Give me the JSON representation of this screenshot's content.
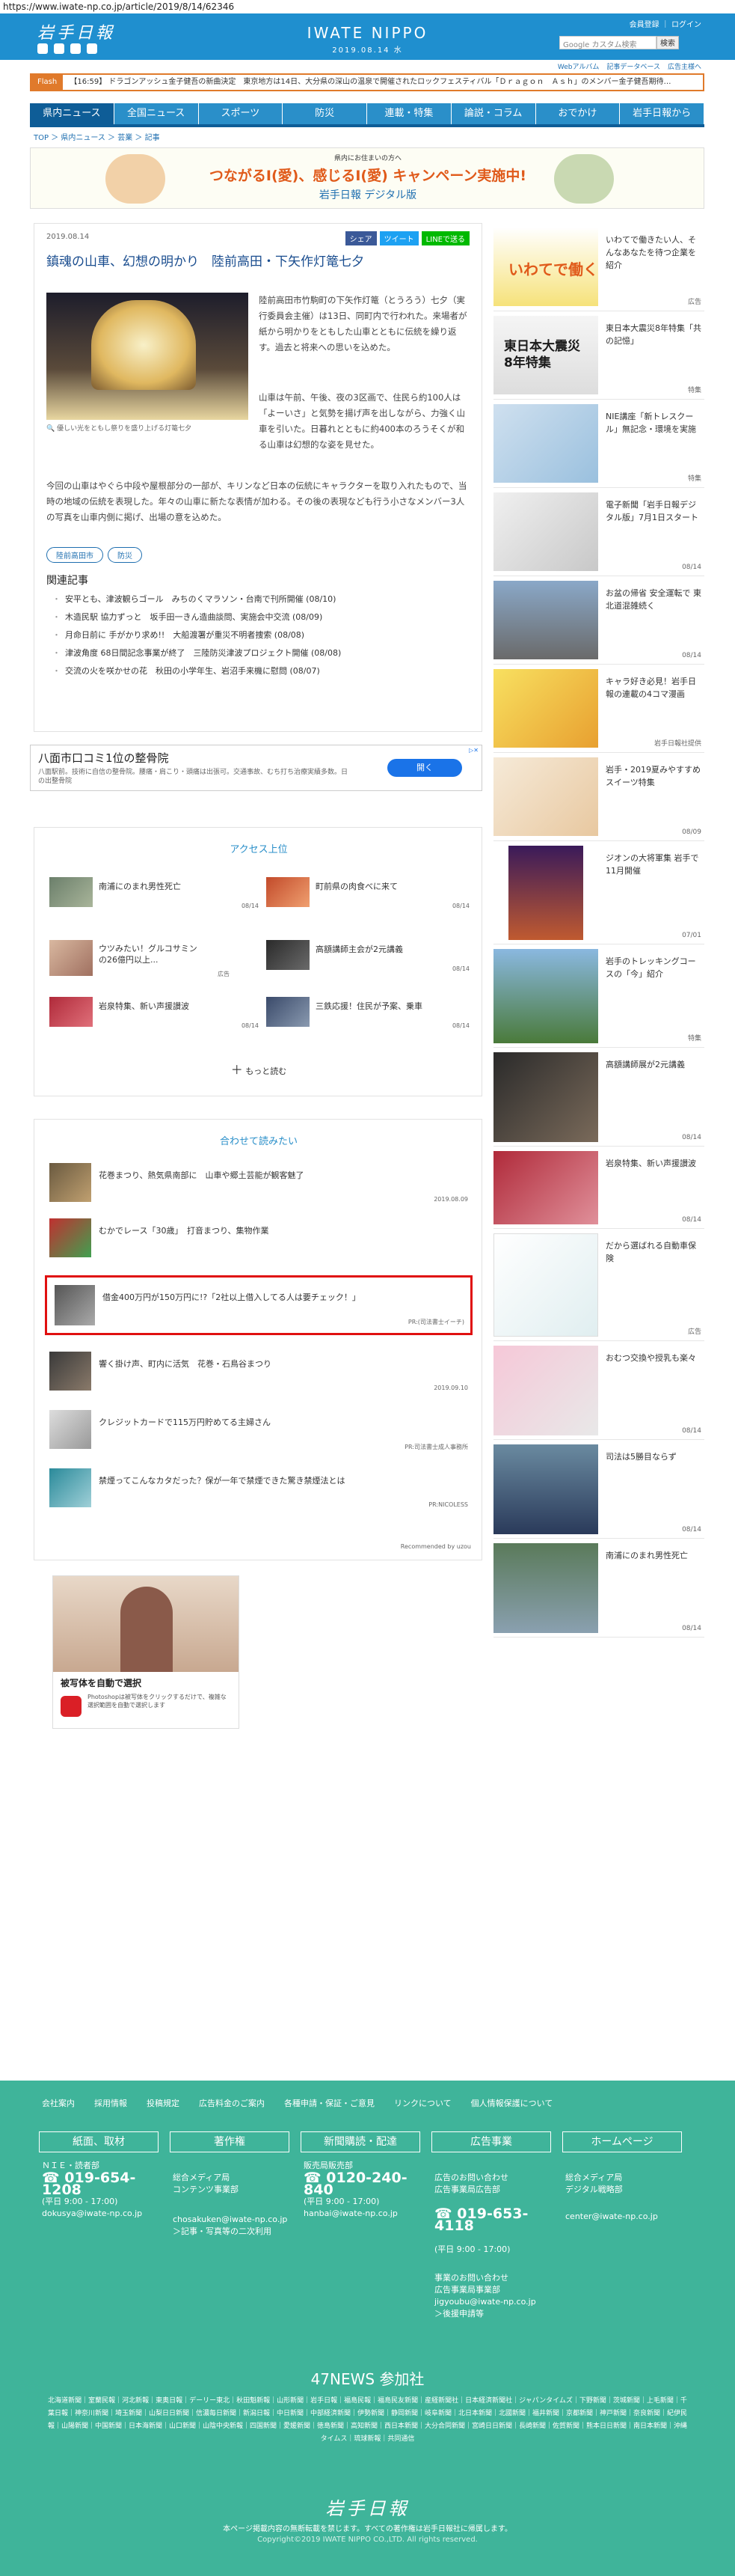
{
  "browser": {
    "url": "https://www.iwate-np.co.jp/article/2019/8/14/62346"
  },
  "header": {
    "logo": "岩手日報",
    "center_logo": "IWATE NIPPO",
    "date_line": "2019.08.14 水",
    "links": [
      "会員登録",
      "ログイン"
    ],
    "sub_links": [
      "Webアルバム",
      "記事データベース",
      "広告主様へ"
    ],
    "search_placeholder": "Google カスタム検索",
    "search_button": "検索"
  },
  "flash": {
    "label": "Flash",
    "text": "【16:59】 ドラゴンアッシュ金子健吾の新曲決定　東京地方は14日、大分県の深山の温泉で開催されたロックフェスティバル「Ｄｒａｇｏｎ　Ａｓｈ」のメンバー金子健吾期待…"
  },
  "nav": [
    "県内ニュース",
    "全国ニュース",
    "スポーツ",
    "防災",
    "連載・特集",
    "論説・コラム",
    "おでかけ",
    "岩手日報から"
  ],
  "breadcrumb": "TOP ＞ 県内ニュース ＞ 芸業 ＞ 記事",
  "banner": {
    "small": "県内にお住まいの方へ",
    "headline": "つながるI(愛)、感じるI(愛) キャンペーン実施中!",
    "sub": "岩手日報 デジタル版"
  },
  "article": {
    "date": "2019.08.14",
    "share": [
      "シェア",
      "ツイート",
      "LINEで送る"
    ],
    "title": "鎮魂の山車、幻想の明かり　陸前高田・下矢作灯篭七夕",
    "caption": "優しい光をともし祭りを盛り上げる灯篭七夕",
    "para1": "陸前高田市竹駒町の下矢作灯篭（とうろう）七夕（実行委員会主催）は13日、同町内で行われた。来場者が紙から明かりをともした山車とともに伝統を繰り返す。過去と将来への思いを込めた。",
    "para2": "山車は午前、午後、夜の3区画で、住民ら約100人は「よーいさ」と気勢を揚げ声を出しながら、力強く山車を引いた。日暮れとともに約400本のろうそくが和る山車は幻想的な姿を見せた。",
    "para3": "今回の山車はやぐら中段や屋根部分の一部が、キリンなど日本の伝統にキャラクターを取り入れたもので、当時の地域の伝統を表現した。年々の山車に新たな表情が加わる。その後の表現なども行う小さなメンバー3人の写真を山車内側に掲げ、出場の意を込めた。",
    "tags": [
      "陸前高田市",
      "防災"
    ],
    "related_title": "関連記事",
    "related": [
      "安平とも、津波観らゴール　みちのくマラソン・台南で刊所開催 (08/10)",
      "木造民駅 協力ずっと　坂手田一きん造曲談問、実施会中交流 (08/09)",
      "月命日前に 手がかり求め!!　大船渡署が重災不明者捜索 (08/08)",
      "津波角度 68日間記念事業が終了　三陸防災津波プロジェクト開催 (08/08)",
      "交流の火を咲かせの花　秋田の小学年生、岩沼手来機に慰問 (08/07)"
    ]
  },
  "ad": {
    "title": "八面市口コミ1位の整骨院",
    "body": "八面駅前。技術に自信の整骨院。腰痛・肩こり・頭痛は出張可。交通事故、むち打ち治療実績多数。日の出整骨院",
    "button": "開く"
  },
  "access": {
    "title": "アクセス上位",
    "items": [
      {
        "text": "南浦にのまれ男性死亡",
        "date": "08/14"
      },
      {
        "text": "町前県の肉食べに来て",
        "date": "08/14"
      },
      {
        "text": "ウツみたい！グルコサミンの26億円以上...",
        "date": "広告"
      },
      {
        "text": "高額講師主会が2元講義",
        "date": "08/14"
      },
      {
        "text": "岩泉特集、新い声援讃波",
        "date": "08/14"
      },
      {
        "text": "三鉄応援！住民が予案、乗車",
        "date": "08/14"
      }
    ],
    "more": "もっと読む"
  },
  "together": {
    "title": "合わせて読みたい",
    "items": [
      {
        "text": "花巻まつり、熱気県南部に　山車や郷土芸能が観客魅了",
        "meta": "2019.08.09"
      },
      {
        "text": "むかでレース「30歳」　打音まつり、集物作業",
        "meta": ""
      },
      {
        "text": "借金400万円が150万円に!?「2社以上借入してる人は要チェック！」",
        "meta": "PR:(司法書士イーチ)"
      },
      {
        "text": "響く掛け声、町内に活気　花巻・石鳥谷まつり",
        "meta": "2019.09.10"
      },
      {
        "text": "クレジットカードで115万円貯めてる主婦さん",
        "meta": "PR:司法書士成人事務所"
      },
      {
        "text": "禁煙ってこんなカタだった？保が一年で禁煙できた驚き禁煙法とは",
        "meta": "PR:NICOLESS"
      }
    ],
    "recommended": "Recommended by uzou"
  },
  "ad2": {
    "heading": "被写体を自動で選択",
    "body": "Photoshopは被写体をクリックするだけで、複雑な選択範囲を自動で選択します"
  },
  "sidebar": [
    {
      "text": "いわてで働きたい人、そんなあなたを待つ企業を紹介",
      "date": "広告"
    },
    {
      "text": "東日本大震災8年特集「共の記憶」",
      "date": "特集"
    },
    {
      "text": "NIE講座「新トレスクール」無記念・環境を実施",
      "date": "特集"
    },
    {
      "text": "電子新聞「岩手日報デジタル版」7月1日スタート",
      "date": "08/14"
    },
    {
      "text": "お盆の帰省 安全運転で 東北道混雑続く",
      "date": "08/14"
    },
    {
      "text": "キャラ好き必見！岩手日報の連載の4コマ漫画",
      "date": "岩手日報社提供"
    },
    {
      "text": "岩手・2019夏みやすすめスイーツ特集",
      "date": "08/09"
    },
    {
      "text": "ジオンの大将軍集 岩手で11月開催",
      "date": "07/01"
    },
    {
      "text": "岩手のトレッキングコースの「今」紹介",
      "date": "特集"
    },
    {
      "text": "高額講師展が2元講義",
      "date": "08/14"
    },
    {
      "text": "岩泉特集、新い声援讃波",
      "date": "08/14"
    },
    {
      "text": "だから選ばれる自動車保険",
      "date": "広告"
    },
    {
      "text": "おむつ交換や授乳も楽々",
      "date": "08/14"
    },
    {
      "text": "司法は5勝目ならず",
      "date": "08/14"
    },
    {
      "text": "南浦にのまれ男性死亡",
      "date": "08/14"
    }
  ],
  "footer": {
    "top_links": [
      "会社案内",
      "採用情報",
      "投稿規定",
      "広告料金のご案内",
      "各種申請・保証・ご意見",
      "リンクについて",
      "個人情報保護について"
    ],
    "boxes": [
      "紙面、取材",
      "著作権",
      "新聞購読・配達",
      "広告事業",
      "ホームページ"
    ],
    "cols": [
      {
        "label": "ＮＩＥ・読者部",
        "tel": "019-654-1208",
        "hours": "(平日 9:00 - 17:00)",
        "mail": "dokusya@iwate-np.co.jp"
      },
      {
        "label": "総合メディア局\nコンテンツ事業部",
        "tel": "",
        "hours": "",
        "mail": "chosakuken@iwate-np.co.jp\n＞記事・写真等の二次利用"
      },
      {
        "label": "販売局販売部",
        "tel": "0120-240-840",
        "hours": "(平日 9:00 - 17:00)",
        "mail": "hanbai@iwate-np.co.jp"
      },
      {
        "label": "広告のお問い合わせ\n広告事業局広告部",
        "tel": "019-653-4118",
        "hours": "(平日 9:00 - 17:00)",
        "mail": "事業のお問い合わせ\n広告事業局事業部\njigyoubu@iwate-np.co.jp\n＞後援申請等"
      },
      {
        "label": "総合メディア局\nデジタル戦略部",
        "tel": "",
        "hours": "",
        "mail": "center@iwate-np.co.jp"
      }
    ],
    "news47_title": "47NEWS 参加社",
    "news47": "北海道新聞｜室蘭民報｜河北新報｜東奥日報｜デーリー東北｜秋田魁新報｜山形新聞｜岩手日報｜福島民報｜福島民友新聞｜産経新聞社｜日本経済新聞社｜ジャパンタイムズ｜下野新聞｜茨城新聞｜上毛新聞｜千葉日報｜神奈川新聞｜埼玉新聞｜山梨日日新聞｜信濃毎日新聞｜新潟日報｜中日新聞｜中部経済新聞｜伊勢新聞｜静岡新聞｜岐阜新聞｜北日本新聞｜北國新聞｜福井新聞｜京都新聞｜神戸新聞｜奈良新聞｜紀伊民報｜山陽新聞｜中国新聞｜日本海新聞｜山口新聞｜山陰中央新報｜四国新聞｜愛媛新聞｜徳島新聞｜高知新聞｜西日本新聞｜大分合同新聞｜宮崎日日新聞｜長崎新聞｜佐賀新聞｜熊本日日新聞｜南日本新聞｜沖縄タイムス｜琉球新報｜共同通信",
    "logo": "岩手日報",
    "notice": "本ページ掲載内容の無断転載を禁じます。すべての著作権は岩手日報社に帰属します。",
    "copyright": "Copyright©2019 IWATE NIPPO CO.,LTD. All rights reserved."
  },
  "colors": {
    "brand": "#1f8fcf",
    "nav": "#2a8fc9",
    "footer": "#3fb49a",
    "flash": "#e07a2b"
  }
}
